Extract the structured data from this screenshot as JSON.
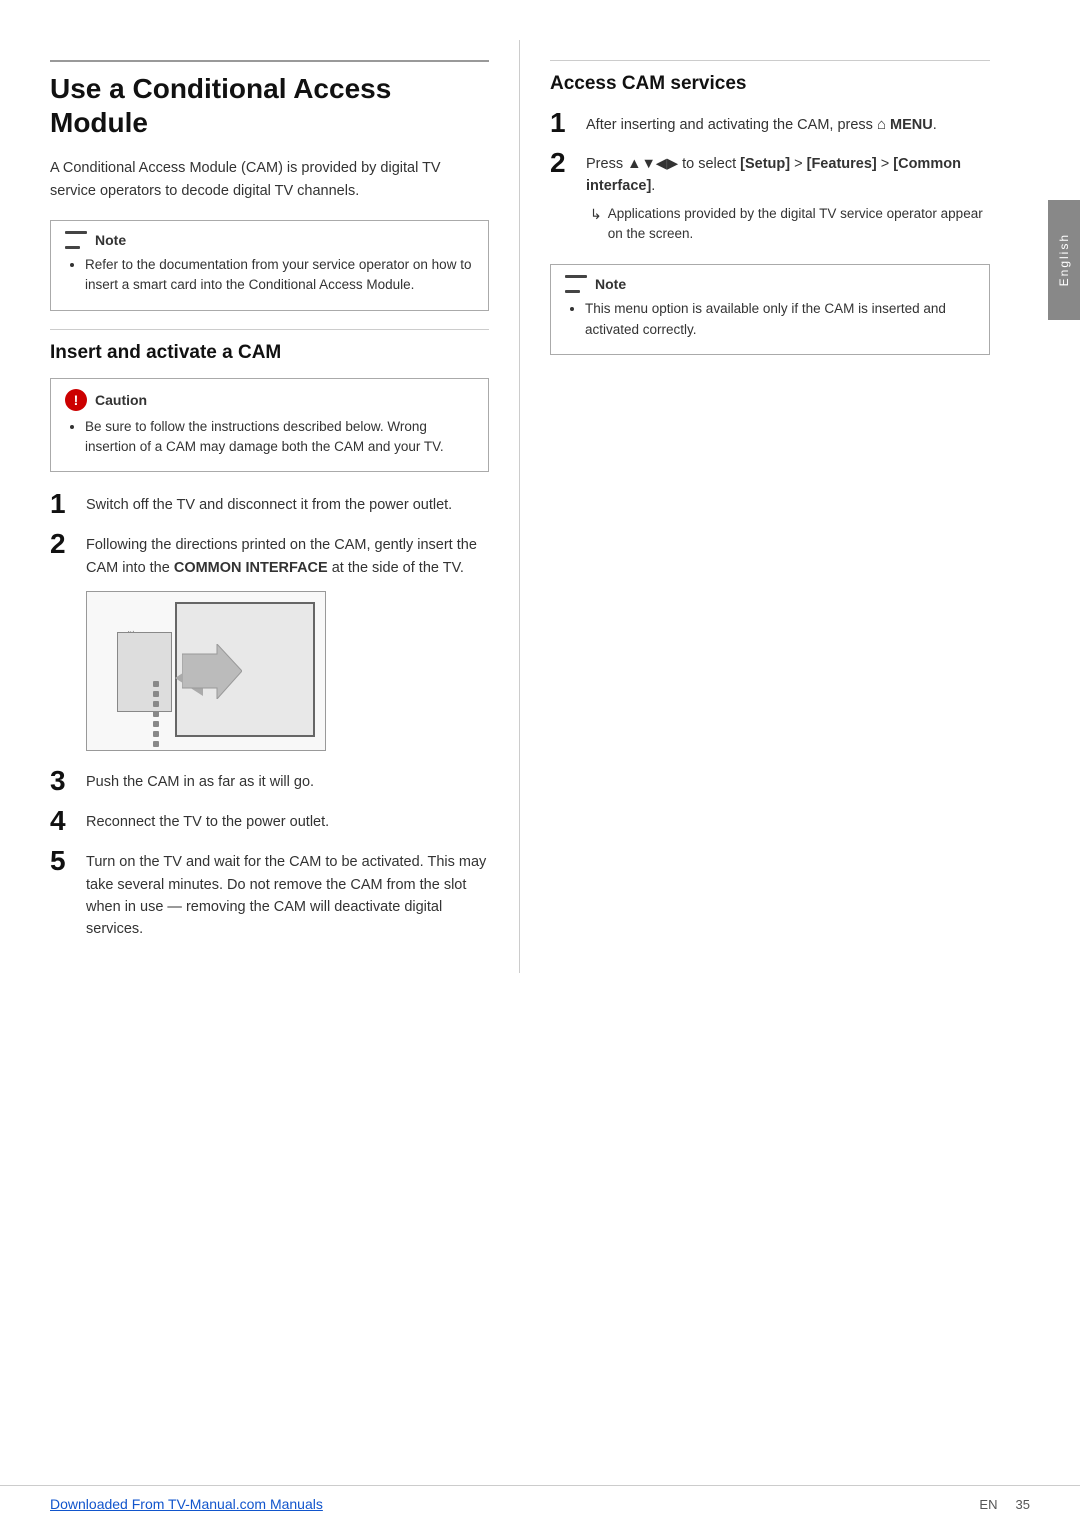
{
  "page": {
    "title": "Use a Conditional Access Module",
    "side_label": "English",
    "intro": "A Conditional Access Module (CAM) is provided by digital TV service operators to decode digital TV channels.",
    "note1": {
      "label": "Note",
      "bullet": "Refer to the documentation from your service operator on how to insert a smart card into the Conditional Access Module."
    },
    "section2_title": "Insert and activate a CAM",
    "caution": {
      "label": "Caution",
      "bullet": "Be sure to follow the instructions described below. Wrong insertion of a CAM may damage both the CAM and your TV."
    },
    "steps_left": [
      {
        "number": "1",
        "text": "Switch off the TV and disconnect it from the power outlet."
      },
      {
        "number": "2",
        "text": "Following the directions printed on the CAM, gently insert the CAM into the COMMON INTERFACE at the side of the TV.",
        "has_bold": [
          "COMMON INTERFACE"
        ]
      },
      {
        "number": "3",
        "text": "Push the CAM in as far as it will go."
      },
      {
        "number": "4",
        "text": "Reconnect the TV to the power outlet."
      },
      {
        "number": "5",
        "text": "Turn on the TV and wait for the CAM to be activated. This may take several minutes. Do not remove the CAM from the slot when in use — removing the CAM will deactivate digital services."
      }
    ],
    "right_col": {
      "section_title": "Access CAM services",
      "steps": [
        {
          "number": "1",
          "text": "After inserting and activating the CAM, press",
          "menu_symbol": "⌂",
          "menu_text": "MENU",
          "text_after": "."
        },
        {
          "number": "2",
          "text_pre": "Press ▲▼◀▶ to select ",
          "bracket1": "[Setup]",
          "text_mid": " > ",
          "bracket2": "[Features]",
          "text_mid2": " > ",
          "bracket3": "[Common interface]",
          "text_end": ".",
          "sub_bullet": "Applications provided by the digital TV service operator appear on the screen."
        }
      ],
      "note2": {
        "label": "Note",
        "bullet": "This menu option is available only if the CAM is inserted and activated correctly."
      }
    },
    "footer": {
      "link_text": "Downloaded From TV-Manual.com Manuals",
      "page_label": "EN",
      "page_number": "35"
    }
  }
}
